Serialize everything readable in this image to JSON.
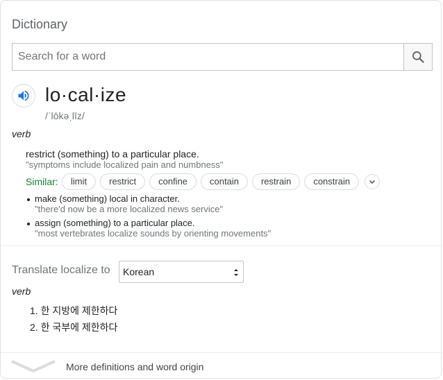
{
  "header": {
    "title": "Dictionary"
  },
  "search": {
    "placeholder": "Search for a word",
    "value": "",
    "icon": "search-icon"
  },
  "entry": {
    "word": "lo·cal·ize",
    "phonetic": "/ˈlōkəˌlīz/",
    "audio_icon": "speaker-icon",
    "part_of_speech": "verb",
    "definition": "restrict (something) to a particular place.",
    "example": "\"symptoms include localized pain and numbness\"",
    "similar_label": "Similar:",
    "similar": [
      "limit",
      "restrict",
      "confine",
      "contain",
      "restrain",
      "constrain"
    ],
    "sub_senses": [
      {
        "definition": "make (something) local in character.",
        "example": "\"there'd now be a more localized news service\""
      },
      {
        "definition": "assign (something) to a particular place.",
        "example": "\"most vertebrates localize sounds by orienting movements\""
      }
    ]
  },
  "translate": {
    "label": "Translate localize to",
    "language": "Korean",
    "part_of_speech": "verb",
    "items": [
      "1. 한 지방에 제한하다",
      "2. 한 국부에 제한하다"
    ]
  },
  "footer": {
    "more_label": "More definitions and word origin"
  },
  "colors": {
    "accent_blue": "#1a73e8",
    "similar_green": "#188038",
    "muted": "#70757a"
  }
}
